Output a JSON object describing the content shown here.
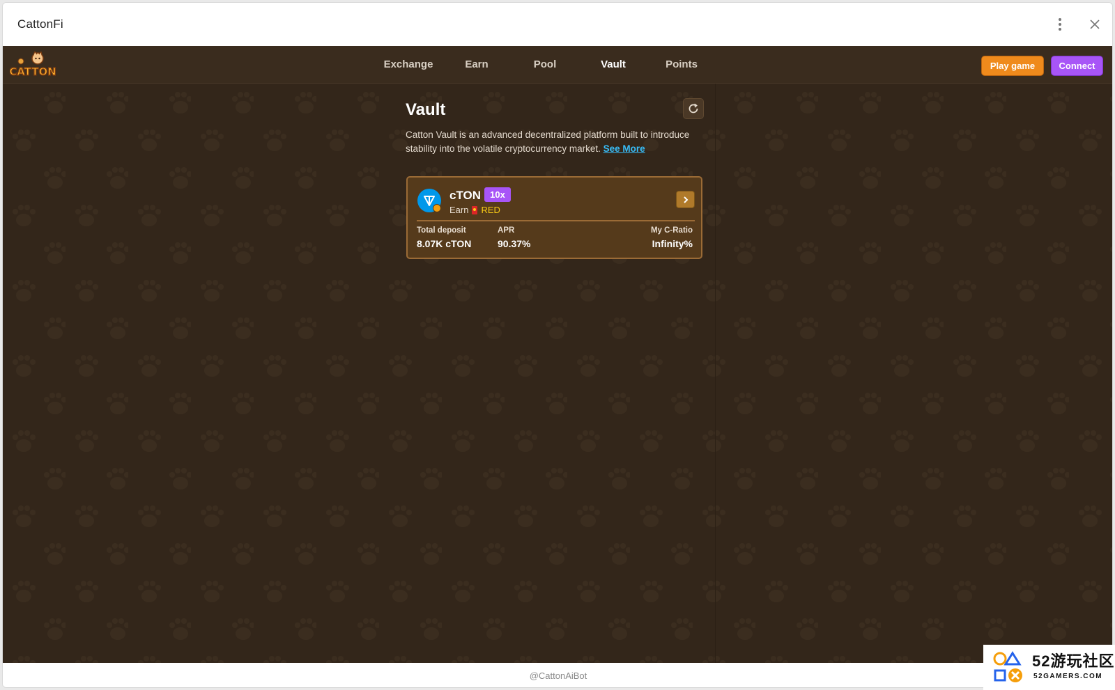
{
  "window": {
    "title": "CattonFi"
  },
  "nav": {
    "logo_text": "CATTON",
    "items": [
      {
        "label": "Exchange",
        "active": false
      },
      {
        "label": "Earn",
        "active": false
      },
      {
        "label": "Pool",
        "active": false
      },
      {
        "label": "Vault",
        "active": true
      },
      {
        "label": "Points",
        "active": false
      }
    ],
    "play_label": "Play game",
    "connect_label": "Connect"
  },
  "vault": {
    "title": "Vault",
    "description": "Catton Vault is an advanced decentralized platform built to introduce stability into the volatile cryptocurrency market.",
    "see_more": "See More",
    "card": {
      "token": "cTON",
      "multiplier": "10x",
      "earn_label": "Earn",
      "earn_token": "RED",
      "total_deposit_label": "Total deposit",
      "total_deposit_value": "8.07K cTON",
      "apr_label": "APR",
      "apr_value": "90.37%",
      "cratio_label": "My C-Ratio",
      "cratio_value": "Infinity%"
    }
  },
  "footer": {
    "bot": "@CattonAiBot"
  },
  "watermark": {
    "big": "52游玩社区",
    "small": "52GAMERS.COM"
  },
  "colors": {
    "background": "#33261a",
    "accent_orange": "#ef8a1c",
    "accent_purple": "#a855f7",
    "link": "#38bdf8"
  }
}
